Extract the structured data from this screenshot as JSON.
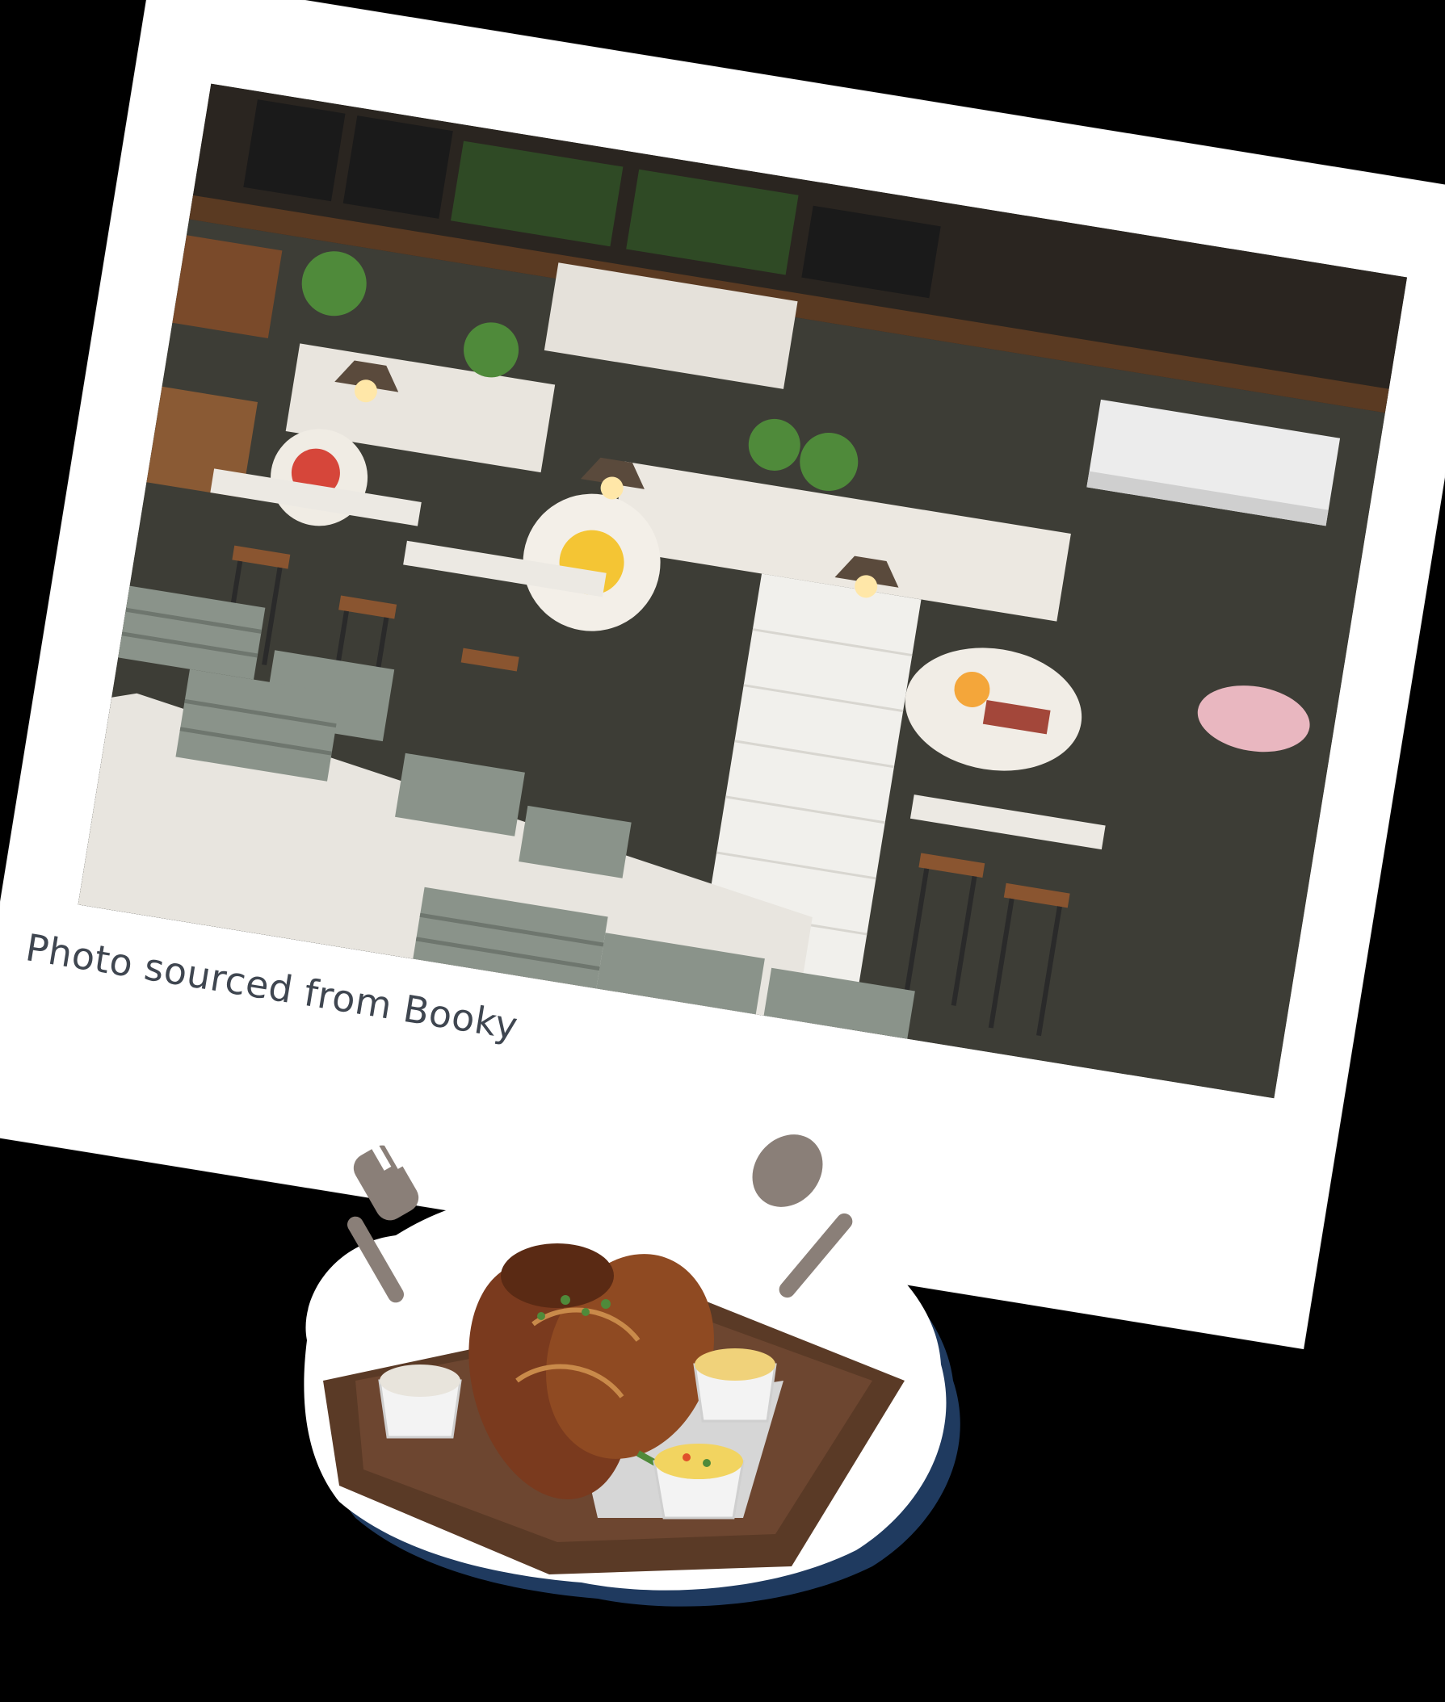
{
  "caption": "Photo sourced from Booky",
  "colors": {
    "background": "#000000",
    "frame": "#ffffff",
    "caption_text": "#3f4650",
    "sticker_shadow": "#1f3a5f",
    "board": "#5a3a26"
  },
  "illustration": {
    "icons": [
      "fork-icon",
      "spoon-icon",
      "roast-chicken-icon",
      "dip-bowl-icon"
    ]
  }
}
